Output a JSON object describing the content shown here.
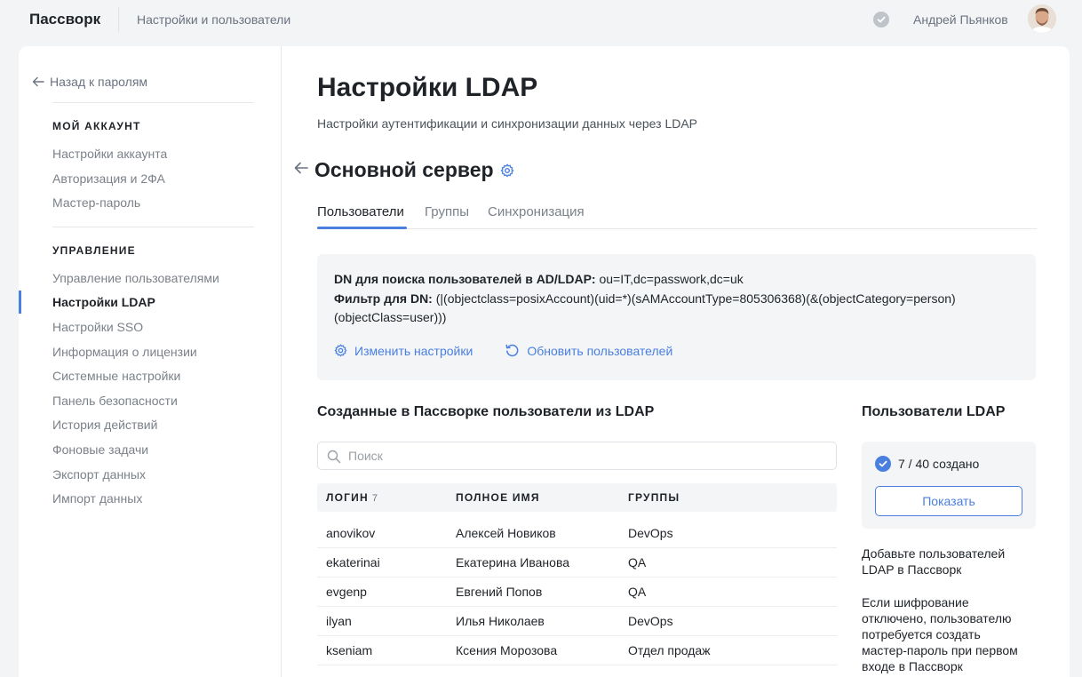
{
  "app": {
    "brand": "Пассворк",
    "breadcrumb": "Настройки и пользователи",
    "user_name": "Андрей Пьянков"
  },
  "sidebar": {
    "back_label": "Назад к паролям",
    "section_account": "МОЙ АККАУНТ",
    "account_items": [
      "Настройки аккаунта",
      "Авторизация и 2ФА",
      "Мастер-пароль"
    ],
    "section_manage": "УПРАВЛЕНИЕ",
    "manage_items": [
      "Управление пользователями",
      "Настройки LDAP",
      "Настройки SSO",
      "Информация о лицензии",
      "Системные настройки",
      "Панель безопасности",
      "История действий",
      "Фоновые задачи",
      "Экспорт данных",
      "Импорт данных"
    ],
    "active_item": "Настройки LDAP"
  },
  "main": {
    "title": "Настройки LDAP",
    "subtitle": "Настройки аутентификации и синхронизации данных через LDAP",
    "server_title": "Основной сервер",
    "tabs": [
      "Пользователи",
      "Группы",
      "Синхронизация"
    ],
    "active_tab": "Пользователи",
    "info": {
      "dn_label": "DN для поиска пользователей в AD/LDAP:",
      "dn_value": "ou=IT,dc=passwork,dc=uk",
      "filter_label": "Фильтр для DN:",
      "filter_value": "(|(objectclass=posixAccount)(uid=*)(sAMAccountType=805306368)(&(objectCategory=person)",
      "filter_value_cont": "(objectClass=user)))",
      "edit_action": "Изменить настройки",
      "refresh_action": "Обновить пользователей"
    },
    "users_section_title": "Созданные в Пассворке пользователи из LDAP",
    "search_placeholder": "Поиск",
    "table": {
      "columns": [
        "ЛОГИН",
        "ПОЛНОЕ ИМЯ",
        "ГРУППЫ"
      ],
      "login_count": "7",
      "rows": [
        {
          "login": "anovikov",
          "name": "Алексей Новиков",
          "group": "DevOps"
        },
        {
          "login": "ekaterinai",
          "name": "Екатерина Иванова",
          "group": "QA"
        },
        {
          "login": "evgenp",
          "name": "Евгений Попов",
          "group": "QA"
        },
        {
          "login": "ilyan",
          "name": "Илья Николаев",
          "group": "DevOps"
        },
        {
          "login": "kseniam",
          "name": "Ксения Морозова",
          "group": "Отдел продаж"
        }
      ]
    },
    "ldap_panel": {
      "title": "Пользователи LDAP",
      "status": "7 / 40 создано",
      "show_button": "Показать",
      "note_1": "Добавьте пользователей LDAP в Пассворк",
      "note_2": "Если шифрование отключено, пользователю потребуется создать мастер-пароль при первом входе в Пассворк"
    }
  },
  "colors": {
    "accent": "#4a7fe0",
    "background": "#f3f4f6",
    "panel": "#f3f5f7"
  }
}
